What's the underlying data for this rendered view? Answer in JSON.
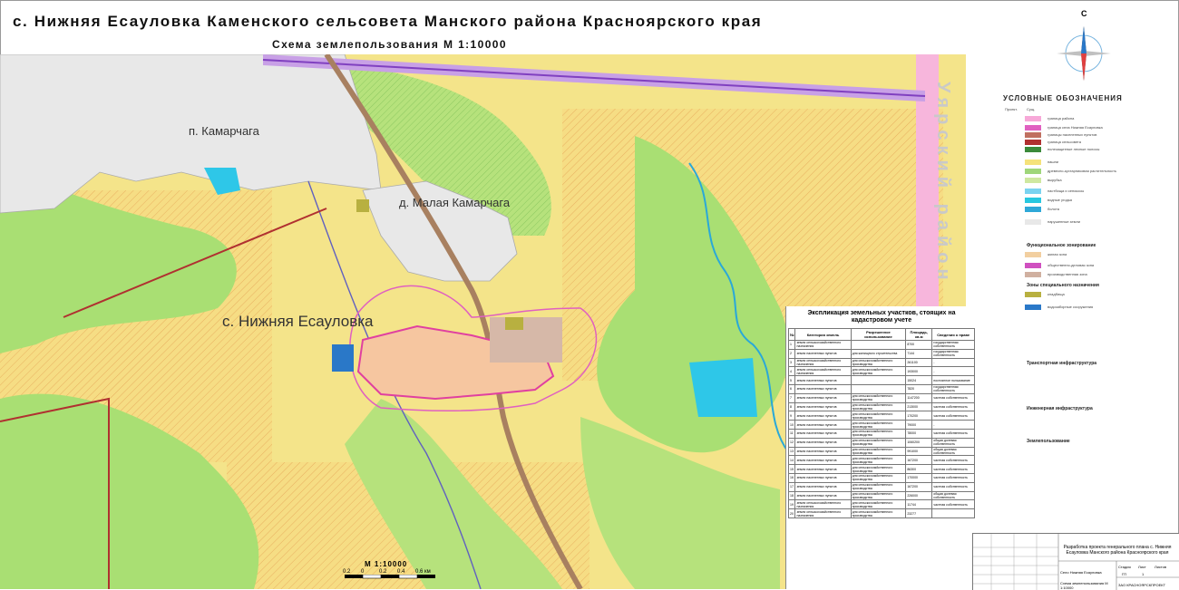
{
  "title": "с. Нижняя Есауловка   Каменского сельсовета Манского района Красноярского края",
  "subtitle": "Схема землепользования М 1:10000",
  "map_labels": {
    "settlement_kamarchaga": "п. Камарчага",
    "settlement_malaya": "д. Малая Камарчага",
    "settlement_main": "с. Нижняя Есауловка",
    "district": "Уярский район",
    "compass_north": "С"
  },
  "legend": {
    "title": "УСЛОВНЫЕ ОБОЗНАЧЕНИЯ",
    "col_proj": "Проект.",
    "col_exist": "Сущ.",
    "sections": {
      "functional_zoning": "Функциональное зонирование",
      "special_zones": "Зоны специального назначения",
      "transport": "Транспортная инфраструктура",
      "engineering": "Инженерная инфраструктура",
      "land_use": "Землепользование"
    },
    "items": [
      {
        "label": "граница района",
        "color": "#f7a8d8"
      },
      {
        "label": "граница села Нижняя Есауловка",
        "color": "#e060c0"
      },
      {
        "label": "границы населенных пунктов",
        "color": "#c07060"
      },
      {
        "label": "граница сельсовета",
        "color": "#b03030"
      },
      {
        "label": "полезащитные лесные полосы",
        "color": "#3b8a3b"
      },
      {
        "label": "пашни",
        "color": "#f5e27a"
      },
      {
        "label": "древесно-кустарниковая растительность",
        "color": "#9fd67a"
      },
      {
        "label": "вырубка",
        "color": "#cfe8a0"
      },
      {
        "label": "пастбища и сенокосы",
        "color": "#7bd3f0"
      },
      {
        "label": "водные угодья",
        "color": "#28c8e0"
      },
      {
        "label": "болота",
        "color": "#2fa8d8"
      },
      {
        "label": "нарушенные земли",
        "color": "#e8e8e8"
      },
      {
        "label": "жилая зона",
        "color": "#f2cfa0"
      },
      {
        "label": "общественно-деловая зона",
        "color": "#d050c0"
      },
      {
        "label": "производственная зона",
        "color": "#d0b0a0"
      },
      {
        "label": "кладбища",
        "color": "#b8b040"
      },
      {
        "label": "водозаборные сооружения",
        "color": "#2a78c8"
      }
    ]
  },
  "land_table": {
    "title": "Экспликация земельных участков, стоящих на кадастровом учете",
    "headers": [
      "№",
      "Категория земель",
      "Разрешенное использование",
      "Площадь, кв.м",
      "Сведения о праве"
    ],
    "rows": [
      [
        "1",
        "земли сельскохозяйственного назначения",
        "",
        "8700",
        "государственная собственность"
      ],
      [
        "2",
        "земли населенных пунктов",
        "для жилищного строительства",
        "7144",
        "государственная собственность"
      ],
      [
        "3",
        "земли сельскохозяйственного назначения",
        "для сельскохозяйственного производства",
        "261100",
        "-"
      ],
      [
        "4",
        "земли сельскохозяйственного назначения",
        "для сельскохозяйственного производства",
        "193000",
        "-"
      ],
      [
        "5",
        "земли населенных пунктов",
        "",
        "15024",
        "постоянное пользование"
      ],
      [
        "6",
        "земли населенных пунктов",
        "",
        "7820",
        "государственная собственность"
      ],
      [
        "7",
        "земли населенных пунктов",
        "для сельскохозяйственного производства",
        "1147200",
        "частная собственность"
      ],
      [
        "8",
        "земли населенных пунктов",
        "для сельскохозяйственного производства",
        "213000",
        "частная собственность"
      ],
      [
        "9",
        "земли населенных пунктов",
        "для сельскохозяйственного производства",
        "170200",
        "частная собственность"
      ],
      [
        "10",
        "земли населенных пунктов",
        "для сельскохозяйственного производства",
        "79000",
        "-"
      ],
      [
        "11",
        "земли населенных пунктов",
        "для сельскохозяйственного производства",
        "78000",
        "частная собственность"
      ],
      [
        "12",
        "земли населенных пунктов",
        "для сельскохозяйственного производства",
        "1060200",
        "общая долевая собственность"
      ],
      [
        "13",
        "земли населенных пунктов",
        "для сельскохозяйственного производства",
        "991000",
        "общая долевая собственность"
      ],
      [
        "14",
        "земли населенных пунктов",
        "для сельскохозяйственного производства",
        "167200",
        "частная собственность"
      ],
      [
        "15",
        "земли населенных пунктов",
        "для сельскохозяйственного производства",
        "86300",
        "частная собственность"
      ],
      [
        "16",
        "земли населенных пунктов",
        "для сельскохозяйственного производства",
        "170000",
        "частная собственность"
      ],
      [
        "17",
        "земли населенных пунктов",
        "для сельскохозяйственного производства",
        "167200",
        "частная собственность"
      ],
      [
        "18",
        "земли населенных пунктов",
        "для сельскохозяйственного производства",
        "226000",
        "общая долевая собственность"
      ],
      [
        "19",
        "земли сельскохозяйственного назначения",
        "для сельскохозяйственного производства",
        "11744",
        "частная собственность"
      ],
      [
        "20",
        "земли сельскохозяйственного назначения",
        "для сельскохозяйственного производства",
        "23277",
        ""
      ]
    ]
  },
  "stamp": {
    "project": "Разработка проекта генерального плана с. Нижняя Есауловка Манского района Красноярского края",
    "village": "Село Нижняя Есауловка",
    "sheet_name": "Схема землепользования М 1:10000",
    "company": "ЗАО КРАСНОЯРСКПРОЕКТ",
    "stage_label": "Стадия",
    "sheet_label": "Лист",
    "sheets_label": "Листов",
    "stage": "ГП",
    "sheet": "1"
  },
  "scale": {
    "title": "М 1:10000",
    "ticks": [
      "0.2",
      "0",
      "0.2",
      "0.4",
      "0.6 км"
    ]
  }
}
